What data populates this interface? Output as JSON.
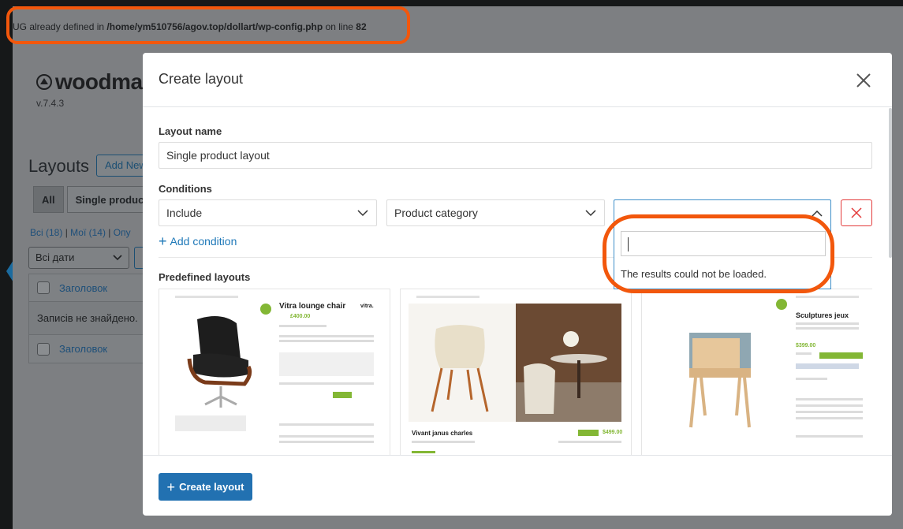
{
  "background": {
    "notice": {
      "prefix": "UG already defined in ",
      "path": "/home/ym510756/agov.top/dollart/wp-config.php",
      "middle": " on line ",
      "line": "82"
    },
    "logo_text": "woodmart",
    "version": "v.7.4.3",
    "page_title": "Layouts",
    "add_new_label": "Add New",
    "tabs": [
      "All",
      "Single product"
    ],
    "filter_links": {
      "all": "Всі (18)",
      "mine": "Мої (14)",
      "published": "Опу"
    },
    "date_filter": "Всі дати",
    "table": {
      "column_header": "Заголовок",
      "empty_message": "Записів не знайдено.",
      "column_footer": "Заголовок"
    }
  },
  "modal": {
    "title": "Create layout",
    "layout_name_label": "Layout name",
    "layout_name_value": "Single product layout",
    "conditions_label": "Conditions",
    "condition_type": "Include",
    "condition_target": "Product category",
    "condition_value": "",
    "add_condition_label": "Add condition",
    "dropdown": {
      "search_value": "",
      "message": "The results could not be loaded."
    },
    "predefined_label": "Predefined layouts",
    "predefined_cards": [
      {
        "title": "Vitra lounge chair",
        "price": "£400.00",
        "brand": "vitra."
      },
      {
        "title": "Vivant janus charles",
        "price": "$499.00"
      },
      {
        "title": "Sculptures jeux",
        "price": "$399.00"
      }
    ],
    "create_button_label": "Create layout"
  },
  "colors": {
    "accent_blue": "#2271b1",
    "annotation_orange": "#f2570c",
    "danger_red": "#e33a3a",
    "woo_green": "#83b735"
  }
}
